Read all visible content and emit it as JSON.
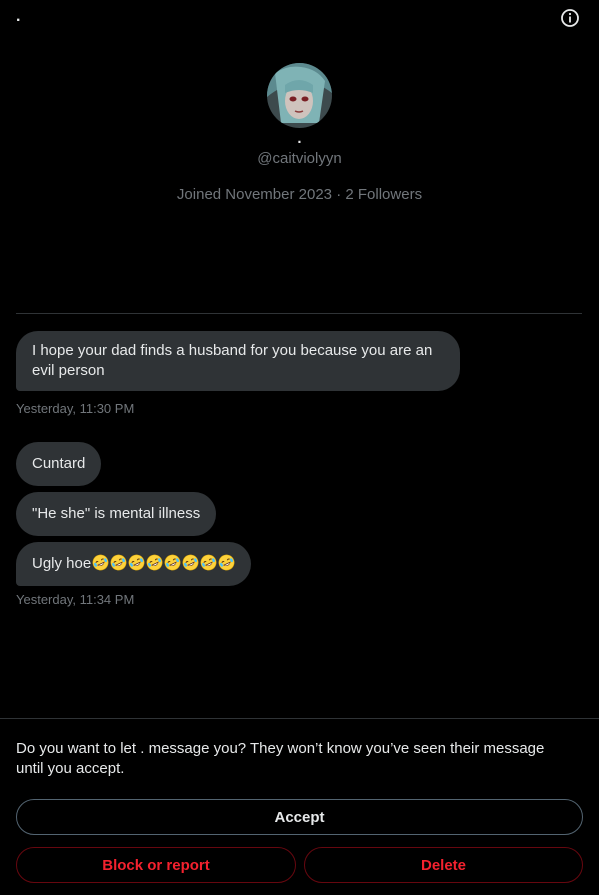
{
  "header": {
    "title": "."
  },
  "profile": {
    "name": ".",
    "handle": "@caitviolyyn",
    "joined": "Joined November 2023",
    "separator": "·",
    "followers": "2 Followers"
  },
  "messages": [
    {
      "text": "I hope your dad finds a husband for you because you are an evil person"
    },
    {
      "text": "Cuntard"
    },
    {
      "text": "\"He she\" is mental illness"
    },
    {
      "text": "Ugly hoe"
    }
  ],
  "timestamps": [
    "Yesterday, 11:30 PM",
    "Yesterday, 11:34 PM"
  ],
  "emoji_name": "rolling-on-floor-laughing-emoji",
  "request": {
    "prompt": "Do you want to let . message you? They won’t know you’ve seen their message until you accept.",
    "accept_label": "Accept",
    "block_label": "Block or report",
    "delete_label": "Delete"
  },
  "colors": {
    "background": "#000000",
    "bubble": "#2f3336",
    "secondary_text": "#71767b",
    "danger": "#f4212e"
  }
}
